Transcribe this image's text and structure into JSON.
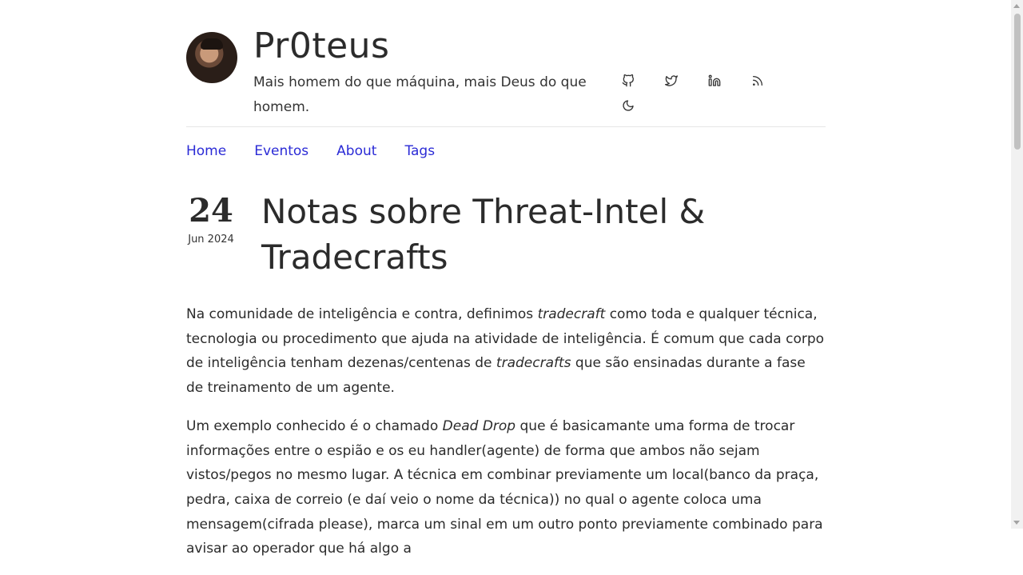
{
  "site": {
    "title": "Pr0teus",
    "tagline": "Mais homem do que máquina, mais Deus do que homem."
  },
  "icons": {
    "github": "github-icon",
    "twitter": "twitter-icon",
    "linkedin": "linkedin-icon",
    "rss": "rss-icon",
    "theme": "moon-icon"
  },
  "nav": {
    "items": [
      {
        "label": "Home"
      },
      {
        "label": "Eventos"
      },
      {
        "label": "About"
      },
      {
        "label": "Tags"
      }
    ]
  },
  "post": {
    "day": "24",
    "month_year": "Jun 2024",
    "title": "Notas sobre Threat-Intel & Tradecrafts",
    "p1": {
      "a": "Na comunidade de inteligência e contra, definimos ",
      "em1": "tradecraft",
      "b": " como toda e qualquer técnica, tecnologia ou procedimento que ajuda na atividade de inteligência. É comum que cada corpo de inteligência tenham dezenas/centenas de ",
      "em2": "tradecrafts",
      "c": " que são ensinadas durante a fase de treinamento de um agente."
    },
    "p2": {
      "a": "Um exemplo conhecido é o chamado ",
      "em1": "Dead Drop",
      "b": " que é basicamante uma forma de trocar informações entre o espião e os eu handler(agente) de forma que ambos não sejam vistos/pegos no mesmo lugar. A técnica em combinar previamente um local(banco da praça, pedra, caixa de correio (e daí veio o nome da técnica)) no qual o agente coloca uma mensagem(cifrada please), marca um sinal em um outro ponto previamente combinado para avisar ao operador que há algo a"
    }
  },
  "colors": {
    "link": "#2b2bd6",
    "text": "#2b2b2b",
    "divider": "#e6e6e6"
  }
}
